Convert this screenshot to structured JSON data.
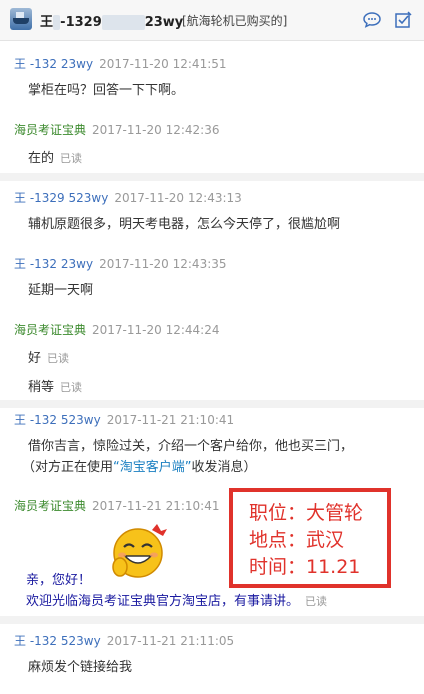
{
  "header": {
    "name_prefix": "王",
    "name_mid": "-1329",
    "name_suffix": "23wy",
    "note": "[航海轮机已购买的]",
    "icons": [
      "chat-bubble-icon",
      "checklist-icon"
    ]
  },
  "messages": [
    {
      "sender": "王 -132 23wy",
      "time": "2017-11-20 12:41:51",
      "lines": [
        "掌柜在吗？回答一下下啊。"
      ],
      "read": ""
    },
    {
      "sender": "海员考证宝典",
      "time": "2017-11-20 12:42:36",
      "lines": [
        "在的"
      ],
      "read": "已读"
    },
    {
      "sender": "王 -1329 523wy",
      "time": "2017-11-20 12:43:13",
      "lines": [
        "辅机原题很多，明天考电器，怎么今天停了，很尴尬啊"
      ],
      "read": ""
    },
    {
      "sender": "王 -132 23wy",
      "time": "2017-11-20 12:43:35",
      "lines": [
        "延期一天啊"
      ],
      "read": ""
    },
    {
      "sender": "海员考证宝典",
      "time": "2017-11-20 12:44:24",
      "lines": [
        "好",
        "稍等"
      ],
      "read": "已读"
    },
    {
      "sender": "王 -132 523wy",
      "time": "2017-11-21 21:10:41",
      "lines": [
        "借你吉言，惊险过关，介绍一个客户给你，他也买三门，"
      ],
      "read": ""
    },
    {
      "sender": "海员考证宝典",
      "time": "2017-11-21 21:10:41",
      "lines": [
        "亲，您好！",
        "欢迎光临海员考证宝典官方淘宝店，有事请讲。"
      ],
      "read": "已读"
    },
    {
      "sender": "王 -132 523wy",
      "time": "2017-11-21 21:11:05",
      "lines": [
        "麻烦发个链接给我"
      ],
      "read": ""
    }
  ],
  "client_note": {
    "prefix": "（对方正在使用",
    "link": "“淘宝客户端”",
    "suffix": "收发消息）"
  },
  "annotation": {
    "line1": "职位：大管轮",
    "line2": "地点：武汉",
    "line3": "时间：11.21"
  },
  "colors": {
    "buyer": "#3d6fbb",
    "seller": "#3c8a2e",
    "annotation": "#e0322b",
    "link": "#1a7fc1"
  }
}
